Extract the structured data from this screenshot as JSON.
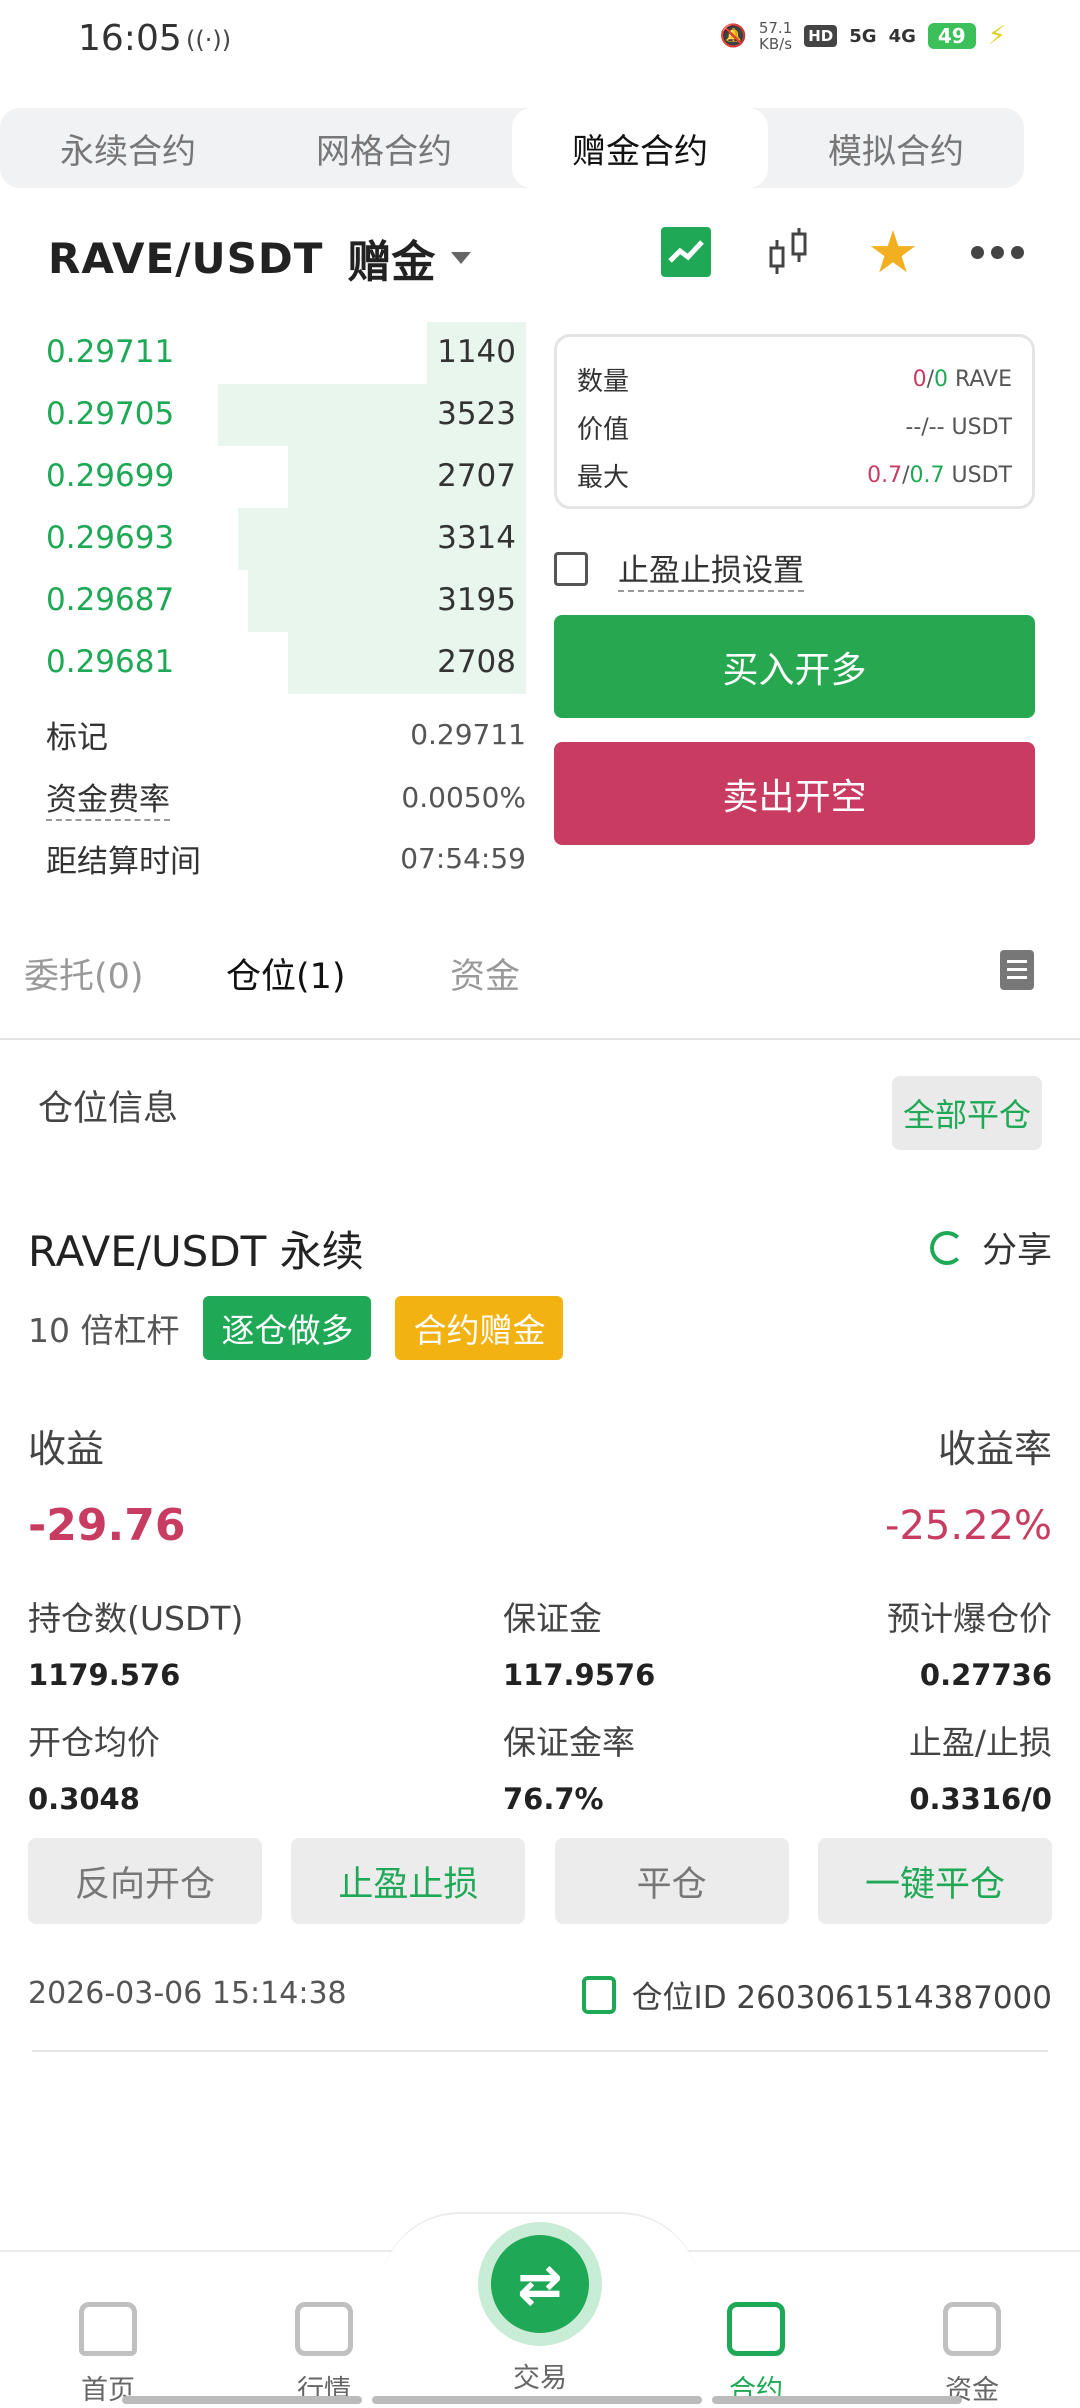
{
  "status_bar": {
    "time": "16:05",
    "radio_icon": "((·))",
    "net_speed_value": "57.1",
    "net_speed_unit": "KB/s",
    "hd": "HD",
    "sig1": "5G",
    "sig2": "4G",
    "battery": "49"
  },
  "top_tabs": [
    {
      "label": "永续合约",
      "active": false
    },
    {
      "label": "网格合约",
      "active": false
    },
    {
      "label": "赠金合约",
      "active": true
    },
    {
      "label": "模拟合约",
      "active": false
    }
  ],
  "pair": {
    "name": "RAVE/USDT",
    "tag": "赠金"
  },
  "order_book": [
    {
      "price": "0.29711",
      "qty": "1140",
      "depth": 0.2
    },
    {
      "price": "0.29705",
      "qty": "3523",
      "depth": 0.62
    },
    {
      "price": "0.29699",
      "qty": "2707",
      "depth": 0.48
    },
    {
      "price": "0.29693",
      "qty": "3314",
      "depth": 0.58
    },
    {
      "price": "0.29687",
      "qty": "3195",
      "depth": 0.56
    },
    {
      "price": "0.29681",
      "qty": "2708",
      "depth": 0.48
    }
  ],
  "market_info": {
    "mark_label": "标记",
    "mark_value": "0.29711",
    "funding_label": "资金费率",
    "funding_value": "0.0050%",
    "settle_label": "距结算时间",
    "settle_value": "07:54:59"
  },
  "order_panel": {
    "qty_label": "数量",
    "qty_a": "0",
    "qty_sep": "/",
    "qty_b": "0",
    "qty_unit": "RAVE",
    "value_label": "价值",
    "value_val": "--/--",
    "value_unit": "USDT",
    "max_label": "最大",
    "max_a": "0.7",
    "max_sep": "/",
    "max_b": "0.7",
    "max_unit": "USDT",
    "tpsl_label": "止盈止损设置",
    "buy_label": "买入开多",
    "sell_label": "卖出开空"
  },
  "sub_tabs": {
    "orders": "委托(0)",
    "positions": "仓位(1)",
    "assets": "资金"
  },
  "position": {
    "section_title": "仓位信息",
    "close_all": "全部平仓",
    "title": "RAVE/USDT 永续",
    "share": "分享",
    "leverage": "10 倍杠杆",
    "badge_mode": "逐仓做多",
    "badge_bonus": "合约赠金",
    "pnl_label": "收益",
    "pnl_rate_label": "收益率",
    "pnl_value": "-29.76",
    "pnl_rate_value": "-25.22%",
    "size_label": "持仓数(USDT)",
    "size_value": "1179.576",
    "margin_label": "保证金",
    "margin_value": "117.9576",
    "liq_label": "预计爆仓价",
    "liq_value": "0.27736",
    "entry_label": "开仓均价",
    "entry_value": "0.3048",
    "margin_ratio_label": "保证金率",
    "margin_ratio_value": "76.7%",
    "tpsl_label": "止盈/止损",
    "tpsl_value": "0.3316/0",
    "actions": {
      "reverse": "反向开仓",
      "tpsl": "止盈止损",
      "close": "平仓",
      "quick_close": "一键平仓"
    },
    "timestamp": "2026-03-06 15:14:38",
    "position_id": "仓位ID 2603061514387000"
  },
  "bottom_nav": {
    "home": "首页",
    "market": "行情",
    "trade": "交易",
    "contract": "合约",
    "assets": "资金"
  },
  "colors": {
    "green": "#1fa855",
    "red": "#c93c62",
    "yellow": "#f2b212"
  }
}
